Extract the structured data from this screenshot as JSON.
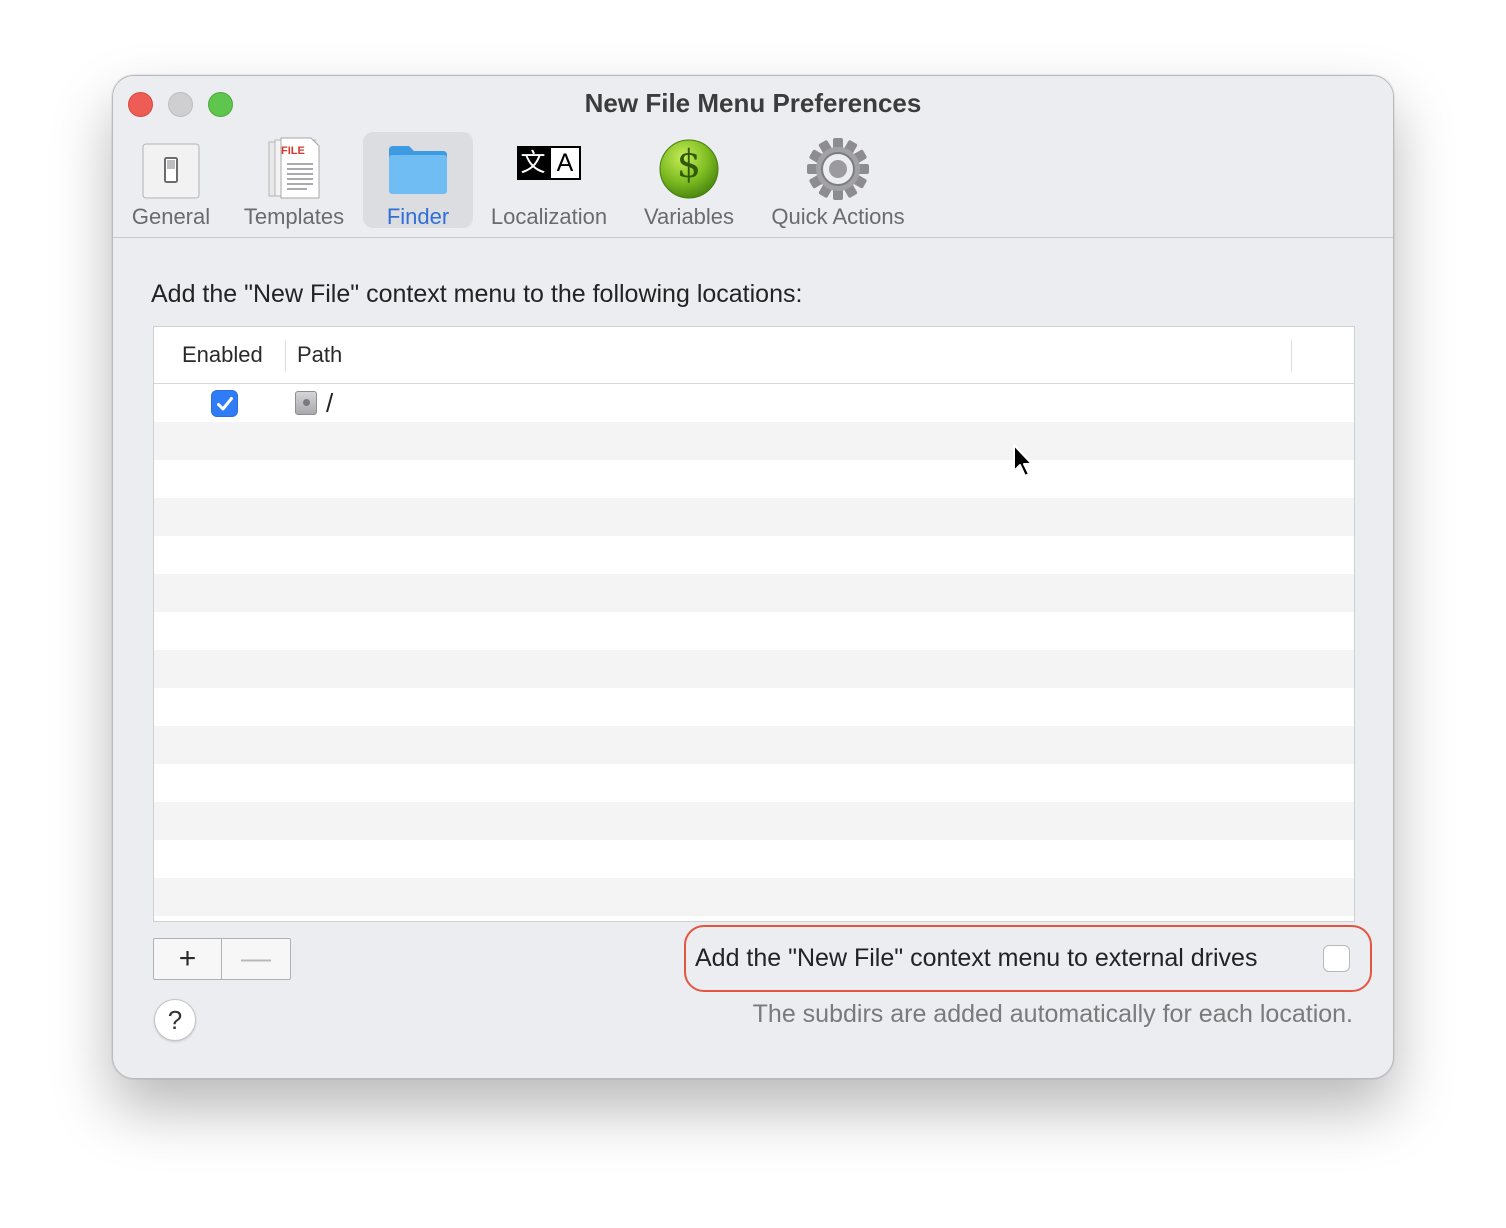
{
  "window": {
    "title": "New File Menu Preferences"
  },
  "toolbar": {
    "items": [
      {
        "label": "General",
        "icon": "switch-icon"
      },
      {
        "label": "Templates",
        "icon": "file-template-icon",
        "badge": "FILE"
      },
      {
        "label": "Finder",
        "icon": "folder-icon",
        "selected": true
      },
      {
        "label": "Localization",
        "icon": "translate-icon",
        "glyph_left": "文",
        "glyph_right": "A"
      },
      {
        "label": "Variables",
        "icon": "dollar-coin-icon",
        "glyph": "$"
      },
      {
        "label": "Quick Actions",
        "icon": "gear-icon"
      }
    ]
  },
  "main": {
    "prompt": "Add the \"New File\" context menu to the following locations:",
    "table": {
      "columns": [
        "Enabled",
        "Path"
      ],
      "rows": [
        {
          "enabled": true,
          "path": "/"
        }
      ]
    },
    "buttons": {
      "add": "+",
      "remove": "—",
      "help": "?"
    },
    "external_drives": {
      "label": "Add the \"New File\" context menu to external drives",
      "checked": false
    },
    "note": "The subdirs are added automatically for each location."
  },
  "colors": {
    "accent": "#2f7cf6",
    "selected_label": "#2e6fd8",
    "highlight_outline": "#e2563f"
  }
}
